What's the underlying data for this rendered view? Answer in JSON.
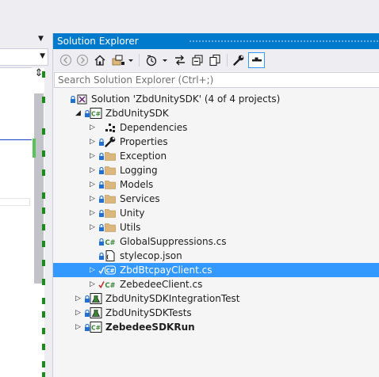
{
  "colors": {
    "accent": "#007acc",
    "selection": "#3399ff",
    "csharp_green": "#388a34",
    "folder": "#dcb67a",
    "lock_blue": "#1e6fd6",
    "check_red": "#c2272d"
  },
  "editor": {
    "split_glyph": "⇕"
  },
  "solution_explorer": {
    "title": "Solution Explorer",
    "toolbar": [
      {
        "name": "back-icon"
      },
      {
        "name": "forward-icon"
      },
      {
        "name": "home-icon"
      },
      {
        "name": "switch-views-icon"
      },
      {
        "name": "dropdown-arrow-icon"
      },
      {
        "name": "pending-changes-filter-icon"
      },
      {
        "name": "sync-with-active-document-icon"
      },
      {
        "name": "collapse-all-icon"
      },
      {
        "name": "show-all-files-icon"
      },
      {
        "name": "properties-wrench-icon"
      },
      {
        "name": "preview-selected-items-icon"
      }
    ],
    "search": {
      "placeholder": "Search Solution Explorer (Ctrl+;)",
      "value": ""
    },
    "tree": [
      {
        "label": "Solution 'ZbdUnitySDK' (4 of 4 projects)",
        "icon": "solution-icon",
        "expander": "",
        "lock": true
      },
      {
        "label": "ZbdUnitySDK",
        "icon": "csharp-project-icon",
        "expander": "expanded",
        "lock": true
      },
      {
        "label": "Dependencies",
        "icon": "dependencies-icon",
        "expander": "collapsed",
        "lock": false
      },
      {
        "label": "Properties",
        "icon": "wrench-icon",
        "expander": "collapsed",
        "lock": true
      },
      {
        "label": "Exception",
        "icon": "folder-icon",
        "expander": "collapsed",
        "lock": true
      },
      {
        "label": "Logging",
        "icon": "folder-icon",
        "expander": "collapsed",
        "lock": true
      },
      {
        "label": "Models",
        "icon": "folder-icon",
        "expander": "collapsed",
        "lock": true
      },
      {
        "label": "Services",
        "icon": "folder-icon",
        "expander": "collapsed",
        "lock": true
      },
      {
        "label": "Unity",
        "icon": "folder-icon",
        "expander": "collapsed",
        "lock": true
      },
      {
        "label": "Utils",
        "icon": "folder-icon",
        "expander": "collapsed",
        "lock": true
      },
      {
        "label": "GlobalSuppressions.cs",
        "icon": "csharp-file-icon",
        "expander": "",
        "lock": true
      },
      {
        "label": "stylecop.json",
        "icon": "json-file-icon",
        "expander": "",
        "lock": true
      },
      {
        "label": "ZbdBtcpayClient.cs",
        "icon": "csharp-class-icon",
        "expander": "collapsed",
        "lock": false,
        "check": true,
        "selected": true
      },
      {
        "label": "ZebedeeClient.cs",
        "icon": "csharp-file-icon",
        "expander": "collapsed",
        "lock": false,
        "check": true
      },
      {
        "label": "ZbdUnitySDKIntegrationTest",
        "icon": "test-project-icon",
        "expander": "collapsed",
        "lock": true
      },
      {
        "label": "ZbdUnitySDKTests",
        "icon": "test-project-icon",
        "expander": "collapsed",
        "lock": true
      },
      {
        "label": "ZebedeeSDKRun",
        "icon": "csharp-project-icon",
        "expander": "collapsed",
        "lock": true,
        "bold": true
      }
    ]
  }
}
